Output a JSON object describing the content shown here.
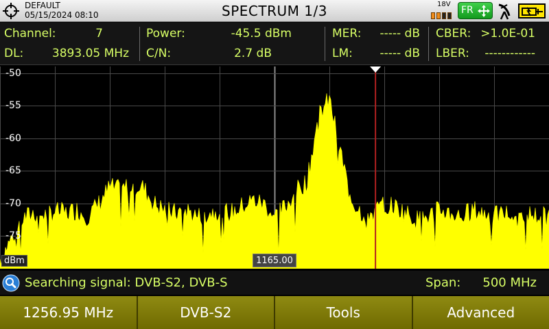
{
  "header": {
    "profile_name": "DEFAULT",
    "datetime": "05/15/2024 08:10",
    "title": "SPECTRUM 1/3",
    "lnb_voltage": "18V",
    "band_badge": "FR",
    "icons": [
      "crosshair-target-icon",
      "arrows-move-icon",
      "satellite-dish-icon",
      "battery-plug-icon"
    ]
  },
  "measurements": {
    "channel_label": "Channel:",
    "channel_value": "7",
    "dl_label": "DL:",
    "dl_value": "3893.05 MHz",
    "power_label": "Power:",
    "power_value": "-45.5 dBm",
    "cn_label": "C/N:",
    "cn_value": "2.7 dB",
    "mer_label": "MER:",
    "mer_value": "----- dB",
    "lm_label": "LM:",
    "lm_value": "----- dB",
    "cber_label": "CBER:",
    "cber_value": ">1.0E-01",
    "lber_label": "LBER:",
    "lber_value": "------------"
  },
  "spectrum": {
    "y_ticks": [
      "-50",
      "-55",
      "-60",
      "-65",
      "-70",
      "-75"
    ],
    "y_unit": "dBm",
    "center_frequency": "1165.00",
    "span_label": "Span:",
    "span_value": "500 MHz"
  },
  "status": {
    "message": "Searching signal: DVB-S2, DVB-S"
  },
  "softkeys": [
    "1256.95 MHz",
    "DVB-S2",
    "Tools",
    "Advanced"
  ],
  "colors": {
    "trace": "#ffff00",
    "value_text": "#d8ff66",
    "marker": "#b22020",
    "softkey": "#857f0a"
  },
  "chart_data": {
    "type": "area",
    "xlabel": "",
    "ylabel": "dBm",
    "x": [
      915,
      925,
      935,
      945,
      955,
      965,
      975,
      985,
      995,
      1005,
      1015,
      1025,
      1035,
      1045,
      1055,
      1065,
      1075,
      1085,
      1095,
      1105,
      1115,
      1125,
      1135,
      1145,
      1155,
      1165,
      1175,
      1185,
      1195,
      1205,
      1215,
      1225,
      1235,
      1245,
      1255,
      1265,
      1275,
      1285,
      1295,
      1305,
      1315,
      1325,
      1335,
      1345,
      1355,
      1365,
      1375,
      1385,
      1395,
      1405,
      1415
    ],
    "values": [
      -78.5,
      -75.5,
      -72.5,
      -71.5,
      -71.8,
      -71.2,
      -71.5,
      -71.0,
      -72.0,
      -70.0,
      -67.5,
      -68.0,
      -67.0,
      -67.5,
      -70.0,
      -71.0,
      -71.5,
      -71.0,
      -72.0,
      -71.5,
      -71.0,
      -71.5,
      -70.5,
      -69.5,
      -70.0,
      -72.0,
      -70.5,
      -68.0,
      -66.5,
      -56.5,
      -54.0,
      -62.0,
      -69.5,
      -71.5,
      -71.5,
      -70.0,
      -70.5,
      -71.5,
      -72.5,
      -72.0,
      -71.0,
      -71.5,
      -72.0,
      -71.0,
      -71.5,
      -72.0,
      -71.5,
      -72.0,
      -71.5,
      -72.0,
      -71.5
    ],
    "ylim": [
      -80,
      -49
    ],
    "y_ticks": [
      -50,
      -55,
      -60,
      -65,
      -70,
      -75
    ],
    "marker_frequency": 1256.95,
    "grid": true
  }
}
